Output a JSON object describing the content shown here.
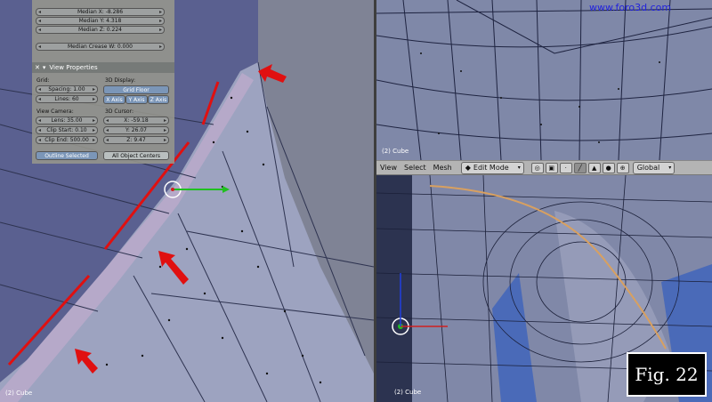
{
  "watermark": "www.foro3d.com",
  "figure_caption": "Fig. 22",
  "transform_panel": {
    "median_x": "Median X: -8.286",
    "median_y": "Median Y: 4.318",
    "median_z": "Median Z: 0.224",
    "median_crease": "Median Crease W: 0.000"
  },
  "view_properties": {
    "title": "View Properties",
    "grid_label": "Grid:",
    "spacing": "Spacing: 1.00",
    "lines": "Lines: 60",
    "display_label": "3D Display:",
    "grid_floor": "Grid Floor",
    "x_axis": "X Axis",
    "y_axis": "Y Axis",
    "z_axis": "Z Axis",
    "view_camera_label": "View Camera:",
    "lens": "Lens: 35.00",
    "clip_start": "Clip Start: 0.10",
    "clip_end": "Clip End: 500.00",
    "cursor_label": "3D Cursor:",
    "cursor_x": "X: -59.18",
    "cursor_y": "Y: 26.07",
    "cursor_z": "Z: 9.47",
    "outline_selected": "Outline Selected",
    "all_object_centers": "All Object Centers"
  },
  "viewports": {
    "left_label": "(2) Cube",
    "top_right_label": "(2) Cube",
    "bottom_right_label": "(2) Cube"
  },
  "header": {
    "view": "View",
    "select": "Select",
    "mesh": "Mesh",
    "mode": "Edit Mode",
    "orientation": "Global"
  },
  "colors": {
    "annotation_red": "#e01010",
    "mesh_blue": "#8a90b0",
    "header_bg": "#b4b4b4",
    "watermark_blue": "#2222dd"
  },
  "icons": [
    "mode-icon",
    "pivot-icon",
    "vertex-select-icon",
    "edge-select-icon",
    "face-select-icon",
    "occlude-icon",
    "manipulator-icon"
  ]
}
